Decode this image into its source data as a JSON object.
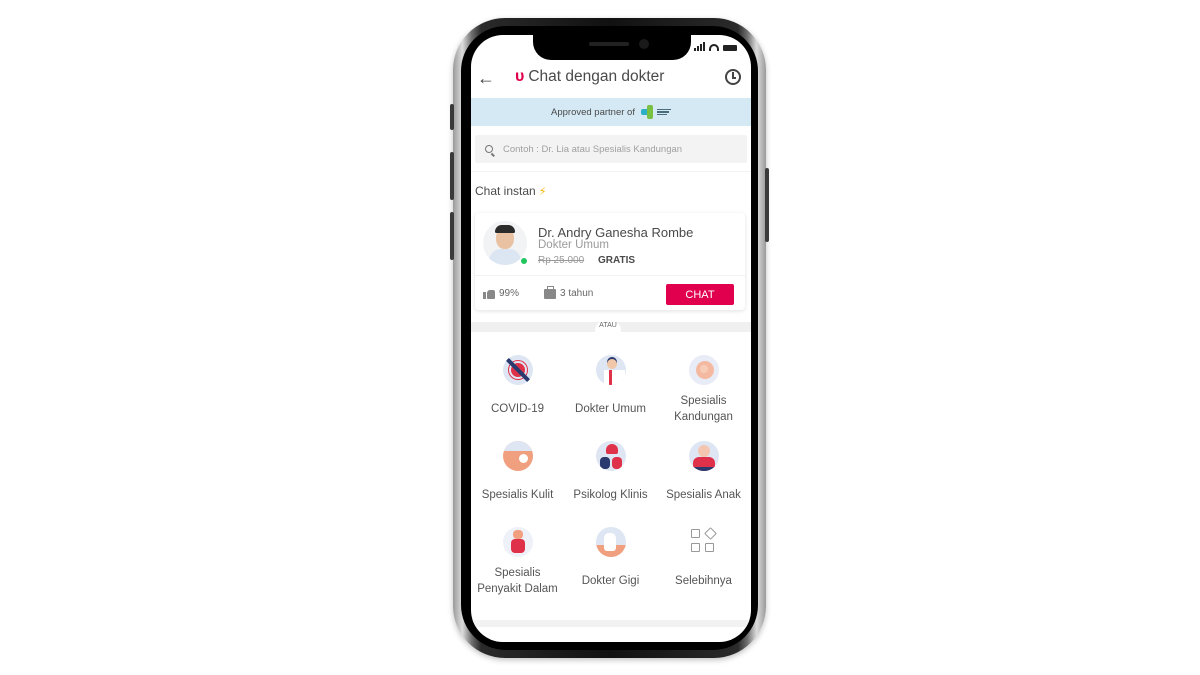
{
  "status_bar": {
    "icons": [
      "signal-icon",
      "wifi-icon",
      "battery-icon"
    ]
  },
  "header": {
    "back_icon": "arrow-left-icon",
    "title_icon": "stethoscope-icon",
    "title": "Chat dengan dokter",
    "history_icon": "history-icon"
  },
  "partner_banner": {
    "text": "Approved partner of",
    "logo": "kemenkes-logo"
  },
  "search": {
    "placeholder": "Contoh : Dr. Lia atau Spesialis Kandungan",
    "value": ""
  },
  "instant_chat": {
    "title": "Chat instan",
    "title_icon": "lightning-icon",
    "doctor": {
      "name": "Dr. Andry Ganesha Rombe",
      "specialty": "Dokter Umum",
      "price_original": "Rp 25.000",
      "price_current": "GRATIS",
      "online": true,
      "rating": "99%",
      "experience": "3 tahun",
      "chat_button": "CHAT"
    }
  },
  "divider_label": "ATAU",
  "categories": [
    {
      "label": "COVID-19",
      "icon": "covid-19-icon"
    },
    {
      "label": "Dokter Umum",
      "icon": "general-doctor-icon"
    },
    {
      "label": "Spesialis Kandungan",
      "icon": "obstetrics-icon"
    },
    {
      "label": "Spesialis Kulit",
      "icon": "dermatology-icon"
    },
    {
      "label": "Psikolog Klinis",
      "icon": "psychology-icon"
    },
    {
      "label": "Spesialis Anak",
      "icon": "pediatrics-icon"
    },
    {
      "label": "Spesialis Penyakit Dalam",
      "icon": "internal-medicine-icon"
    },
    {
      "label": "Dokter Gigi",
      "icon": "dentist-icon"
    },
    {
      "label": "Selebihnya",
      "icon": "more-categories-icon"
    }
  ],
  "colors": {
    "brand": "#e0004d",
    "banner_bg": "#d4e9f4",
    "online": "#22c55e",
    "bolt": "#f5b400"
  }
}
